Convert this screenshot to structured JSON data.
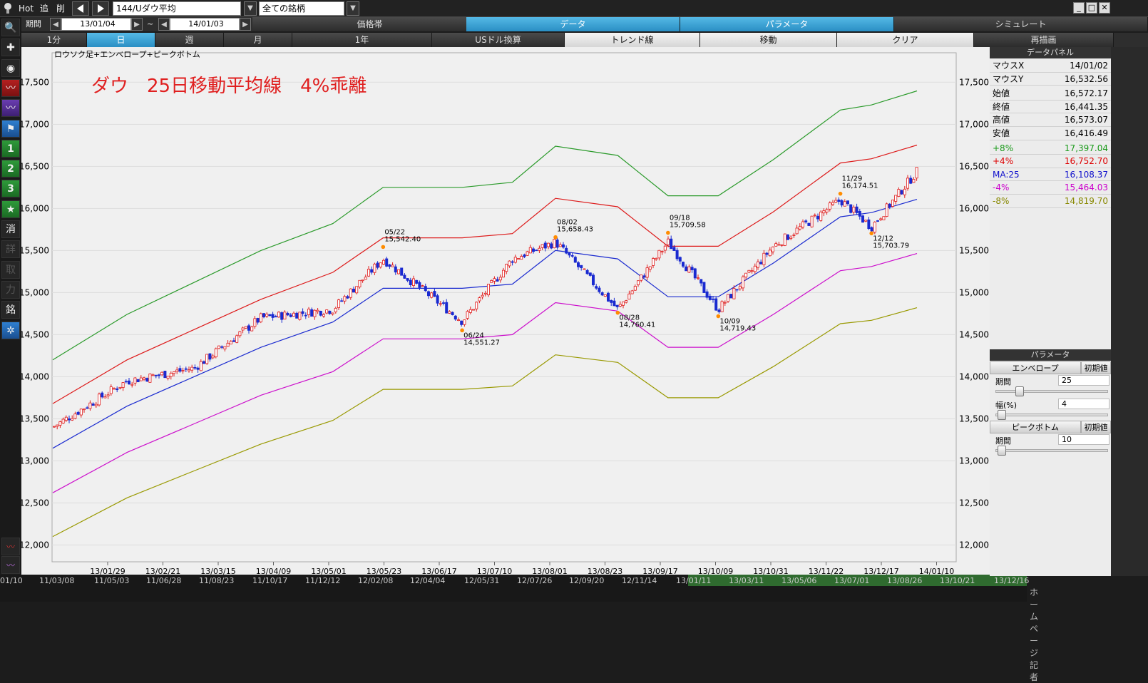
{
  "toolbar": {
    "hot": "Hot",
    "add": "追",
    "del": "削",
    "symbol": "144/Uダウ平均",
    "list": "全ての銘柄"
  },
  "period": {
    "label": "期間",
    "from": "13/01/04",
    "tilde": "~",
    "to": "14/01/03"
  },
  "tabs_top": [
    "価格帯",
    "データ",
    "パラメータ",
    "シミュレート"
  ],
  "tabs_second": [
    "1分",
    "日",
    "週",
    "月",
    "1年",
    "USドル換算",
    "トレンド線",
    "移動",
    "クリア",
    "再描画"
  ],
  "left_tools": [
    "search-icon",
    "crosshair-icon",
    "camera-icon",
    "red-chart-icon",
    "purple-chart-icon",
    "flag-icon",
    "1",
    "2",
    "3",
    "★",
    "消",
    "詳",
    "取",
    "力",
    "銘",
    "gear-icon"
  ],
  "chart": {
    "subtitle": "ロウソク足+エンベロープ+ピークボトム",
    "overlay": "ダウ　25日移動平均線　4%乖離",
    "yticks": [
      "17,500",
      "17,000",
      "16,500",
      "16,000",
      "15,500",
      "15,000",
      "14,500",
      "14,000",
      "13,500",
      "13,000",
      "12,500",
      "12,000"
    ],
    "xticks": [
      "13/01/29",
      "13/02/21",
      "13/03/15",
      "13/04/09",
      "13/05/01",
      "13/05/23",
      "13/06/17",
      "13/07/10",
      "13/08/01",
      "13/08/23",
      "13/09/17",
      "13/10/09",
      "13/10/31",
      "13/11/22",
      "13/12/17",
      "14/01/10"
    ],
    "annotations": [
      {
        "d": "05/22",
        "v": "15,542.40"
      },
      {
        "d": "06/24",
        "v": "14,551.27"
      },
      {
        "d": "08/02",
        "v": "15,658.43"
      },
      {
        "d": "08/28",
        "v": "14,760.41"
      },
      {
        "d": "09/18",
        "v": "15,709.58"
      },
      {
        "d": "10/09",
        "v": "14,719.43"
      },
      {
        "d": "11/29",
        "v": "16,174.51"
      },
      {
        "d": "12/12",
        "v": "15,703.79"
      }
    ]
  },
  "chart_data": {
    "type": "line",
    "title": "ダウ　25日移動平均線　4%乖離",
    "ylim": [
      11800,
      17850
    ],
    "x": [
      "2013-01-04",
      "2013-02-04",
      "2013-03-04",
      "2013-04-01",
      "2013-05-01",
      "2013-05-22",
      "2013-06-24",
      "2013-07-15",
      "2013-08-02",
      "2013-08-28",
      "2013-09-18",
      "2013-10-09",
      "2013-11-01",
      "2013-11-29",
      "2013-12-12",
      "2013-12-31"
    ],
    "series": [
      {
        "name": "MA:25",
        "values": [
          13150,
          13650,
          14000,
          14350,
          14650,
          15050,
          15050,
          15100,
          15500,
          15400,
          14950,
          14950,
          15350,
          15900,
          15950,
          16108
        ]
      },
      {
        "name": "+4%",
        "values": [
          13680,
          14200,
          14560,
          14920,
          15240,
          15650,
          15650,
          15700,
          16120,
          16020,
          15550,
          15550,
          15960,
          16540,
          16590,
          16753
        ]
      },
      {
        "name": "+8%",
        "values": [
          14200,
          14740,
          15120,
          15500,
          15820,
          16250,
          16250,
          16310,
          16740,
          16630,
          16150,
          16150,
          16580,
          17170,
          17230,
          17397
        ]
      },
      {
        "name": "-4%",
        "values": [
          12620,
          13100,
          13440,
          13780,
          14060,
          14450,
          14450,
          14500,
          14880,
          14780,
          14350,
          14350,
          14740,
          15260,
          15310,
          15464
        ]
      },
      {
        "name": "-8%",
        "values": [
          12100,
          12560,
          12880,
          13200,
          13480,
          13850,
          13850,
          13890,
          14260,
          14170,
          13750,
          13750,
          14120,
          14630,
          14670,
          14820
        ]
      },
      {
        "name": "Close",
        "values": [
          13400,
          13950,
          14100,
          14700,
          14800,
          15400,
          14660,
          15400,
          15600,
          14800,
          15600,
          14800,
          15550,
          16100,
          15780,
          16441
        ]
      }
    ]
  },
  "bottom_dates": [
    "01/10",
    "11/03/08",
    "11/05/03",
    "11/06/28",
    "11/08/23",
    "11/10/17",
    "11/12/12",
    "12/02/08",
    "12/04/04",
    "12/05/31",
    "12/07/26",
    "12/09/20",
    "12/11/14",
    "13/01/11",
    "13/03/11",
    "13/05/06",
    "13/07/01",
    "13/08/26",
    "13/10/21",
    "13/12/16"
  ],
  "bottom_right": "ホームページ 記者",
  "datapanel": {
    "header": "データパネル",
    "rows": [
      {
        "l": "マウスX",
        "v": "14/01/02"
      },
      {
        "l": "マウスY",
        "v": "16,532.56"
      },
      {
        "l": "始値",
        "v": "16,572.17"
      },
      {
        "l": "終値",
        "v": "16,441.35"
      },
      {
        "l": "高値",
        "v": "16,573.07"
      },
      {
        "l": "安値",
        "v": "16,416.49"
      },
      {
        "l": "+8%",
        "v": "17,397.04"
      },
      {
        "l": "+4%",
        "v": "16,752.70"
      },
      {
        "l": "MA:25",
        "v": "16,108.37"
      },
      {
        "l": "-4%",
        "v": "15,464.03"
      },
      {
        "l": "-8%",
        "v": "14,819.70"
      }
    ],
    "colors": [
      "#000",
      "#000",
      "#000",
      "#000",
      "#000",
      "#000",
      "#1a9a1a",
      "#dd0000",
      "#1111cc",
      "#cc00cc",
      "#888800"
    ]
  },
  "params": {
    "header": "パラメータ",
    "envelope": "エンベロープ",
    "init": "初期値",
    "period_label": "期間",
    "period_val": "25",
    "width_label": "幅(%)",
    "width_val": "4",
    "peak": "ピークボトム",
    "peak_init": "初期値",
    "peak_period_label": "期間",
    "peak_period_val": "10"
  }
}
